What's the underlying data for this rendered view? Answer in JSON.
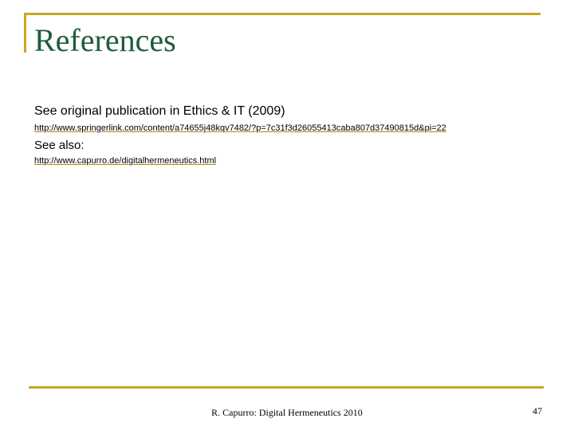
{
  "slide": {
    "title": "References",
    "lines": [
      "See original publication in Ethics & IT (2009)",
      "See also:"
    ],
    "links": [
      "http://www.springerlink.com/content/a74655j48kqv7482/?p=7c31f3d26055413caba807d37490815d&pi=22",
      "http://www.capurro.de/digitalhermeneutics.html"
    ],
    "footer": "R. Capurro: Digital Hermeneutics 2010",
    "page_number": "47",
    "colors": {
      "title": "#1e5c3c",
      "accent_rule": "#c8a820"
    }
  }
}
